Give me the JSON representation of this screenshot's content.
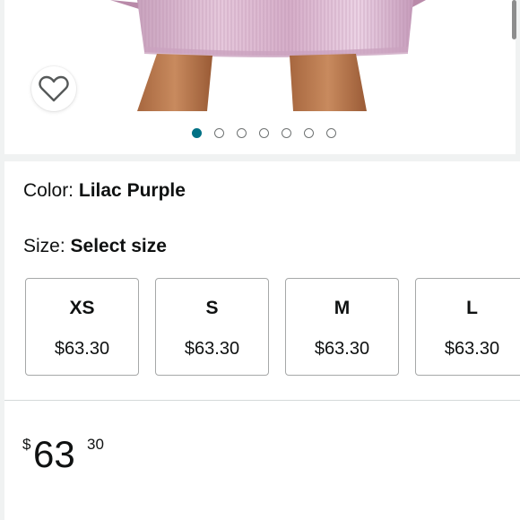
{
  "gallery": {
    "wishlist_icon": "heart-outline-icon",
    "dots_total": 7,
    "active_index": 0,
    "accent_color": "#007185"
  },
  "variant": {
    "color_label": "Color:",
    "color_value": "Lilac Purple",
    "size_label": "Size:",
    "size_value": "Select size"
  },
  "sizes": [
    {
      "name": "XS",
      "price": "$63.30"
    },
    {
      "name": "S",
      "price": "$63.30"
    },
    {
      "name": "M",
      "price": "$63.30"
    },
    {
      "name": "L",
      "price": "$63.30"
    }
  ],
  "price": {
    "symbol": "$",
    "whole": "63",
    "fraction": "30"
  }
}
